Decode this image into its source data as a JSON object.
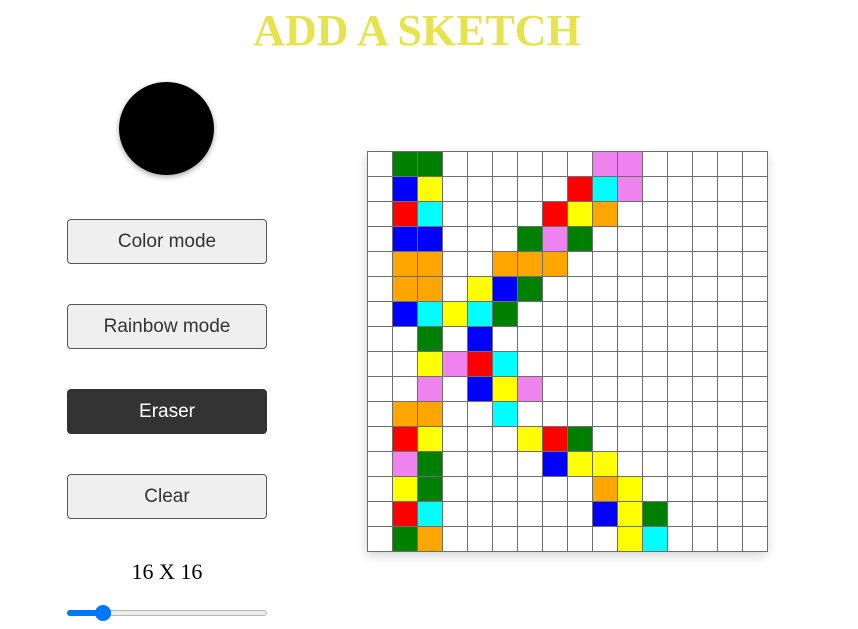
{
  "title": "ADD A SKETCH",
  "picker": {
    "current_color": "#000000"
  },
  "buttons": {
    "color_mode": "Color mode",
    "rainbow_mode": "Rainbow mode",
    "eraser": "Eraser",
    "clear": "Clear"
  },
  "active_mode": "eraser",
  "size": {
    "label": "16 X 16",
    "value": 16,
    "min": 1,
    "max": 100
  },
  "palette": {
    "W": "#ffffff",
    "G": "#008000",
    "B": "#0000ff",
    "R": "#ff0000",
    "Y": "#ffff00",
    "C": "#00ffff",
    "V": "#ee82ee",
    "O": "#ffa500"
  },
  "grid_rows": [
    "WGGWWWWWWVVWWWWW",
    "WBYWWWWWRCVWWWWW",
    "WRCWWWWRYOWWWWWW",
    "WBBWWWGVGWWWWWWW",
    "WOOWWOOOWWWWWWWW",
    "WOOWYBGWWWWWWWWW",
    "WBCYCGWWWWWWWWWW",
    "WWGWBWWWWWWWWWWW",
    "WWYVRCWWWWWWWWWW",
    "WWVWBYVWWWWWWWWW",
    "WOOWWCWWWWWWWWWW",
    "WRYWWWYRGWWWWWWW",
    "WVGWWWWBYYWWWWWW",
    "WYGWWWWWWOYWWWWW",
    "WRCWWWWWWBYGWWWW",
    "WGOWWWWWWWYCWWWW"
  ]
}
